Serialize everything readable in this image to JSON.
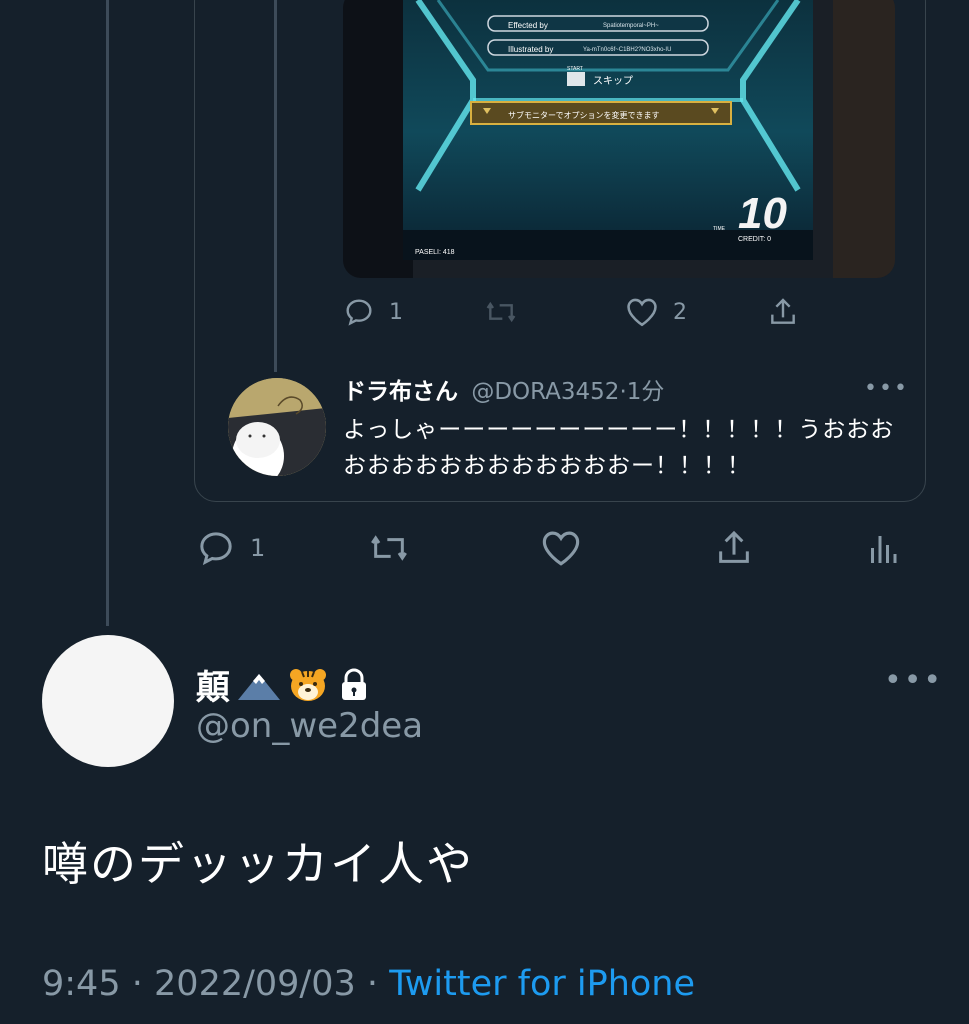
{
  "quoted_media": {
    "effected_by_label": "Effected by",
    "effected_by_value": "Spatiotemporal~PH~",
    "illustrated_by_label": "Illustrated by",
    "illustrated_by_value": "Ya-mTn0c6f~C1BH2?NO3xho-IU",
    "start_label": "START",
    "skip_label": "スキップ",
    "submonitor_text": "サブモニターでオプションを変更できます",
    "time_label": "TIME",
    "timer_value": "10",
    "credit_text": "CREDIT: 0",
    "pasel_text": "PASELI: 418"
  },
  "parent_actions": {
    "reply_count": "1",
    "like_count": "2"
  },
  "quoted_tweet": {
    "name": "ドラ布さん",
    "handle": "@DORA3452",
    "separator": "·",
    "time": "1分",
    "more": "•••",
    "text": "よっしゃーーーーーーーーーー！！！！！うおおおおおおおおおおおおおおおー！！！！"
  },
  "quote_actions": {
    "reply_count": "1"
  },
  "main_tweet": {
    "name": "顛",
    "emoji": [
      "mount-fuji-icon",
      "tiger-face-icon",
      "lock-icon"
    ],
    "handle": "@on_we2dea",
    "more": "•••",
    "text": "噂のデッッカイ人や",
    "time": "9:45",
    "sep1": "·",
    "date": "2022/09/03",
    "sep2": "·",
    "source": "Twitter for iPhone"
  },
  "colors": {
    "background": "#15202b",
    "secondary_text": "#8899a6",
    "link": "#1d9bf0",
    "border": "#38444d"
  }
}
